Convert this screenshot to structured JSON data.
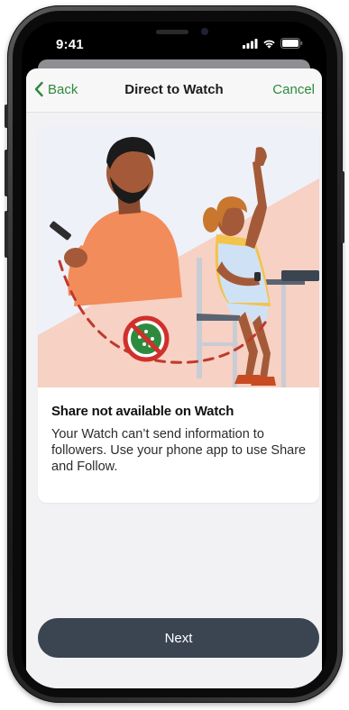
{
  "status_bar": {
    "time": "9:41"
  },
  "nav": {
    "back_label": "Back",
    "title": "Direct to Watch",
    "cancel_label": "Cancel"
  },
  "card": {
    "title": "Share not available on Watch",
    "body": "Your Watch can’t send information to followers. Use your phone app to use Share and Follow."
  },
  "footer": {
    "next_label": "Next"
  },
  "colors": {
    "accent_green": "#2c8a3a",
    "button_dark": "#3b4552",
    "sheet_background": "#f2f2f4",
    "illustration_sky": "#eef1f8",
    "illustration_peach": "#f6d1c4",
    "dashed_line": "#c0392b",
    "no_sign_red": "#d0302b",
    "no_sign_green": "#2e8b3e"
  },
  "icons": {
    "back": "chevron-left-icon",
    "signal": "cellular-signal-icon",
    "wifi": "wifi-icon",
    "battery": "battery-icon",
    "not_allowed": "prohibited-share-icon"
  }
}
